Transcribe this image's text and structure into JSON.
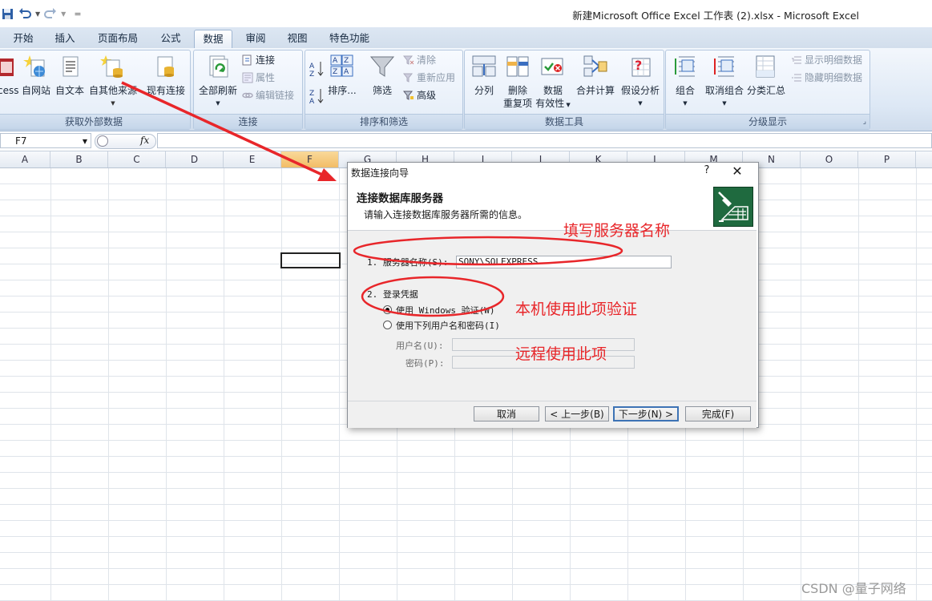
{
  "window": {
    "title": "新建Microsoft Office Excel 工作表 (2).xlsx - Microsoft Excel"
  },
  "quick_access": {
    "separator": "="
  },
  "tabs": [
    {
      "label": "开始",
      "active": false
    },
    {
      "label": "插入",
      "active": false
    },
    {
      "label": "页面布局",
      "active": false
    },
    {
      "label": "公式",
      "active": false
    },
    {
      "label": "数据",
      "active": true
    },
    {
      "label": "审阅",
      "active": false
    },
    {
      "label": "视图",
      "active": false
    },
    {
      "label": "特色功能",
      "active": false
    }
  ],
  "ribbon": {
    "groups": {
      "external": {
        "label": "获取外部数据",
        "buttons": [
          "cess",
          "自网站",
          "自文本",
          "自其他来源",
          "现有连接"
        ]
      },
      "connections": {
        "label": "连接",
        "refresh_all": "全部刷新",
        "connections": "连接",
        "properties": "属性",
        "edit_links": "编辑链接"
      },
      "sort_filter": {
        "label": "排序和筛选",
        "sort": "排序...",
        "filter": "筛选",
        "clear": "清除",
        "reapply": "重新应用",
        "advanced": "高级"
      },
      "data_tools": {
        "label": "数据工具",
        "text_to_columns": "分列",
        "remove_dup_1": "删除",
        "remove_dup_2": "重复项",
        "validation_1": "数据",
        "validation_2": "有效性",
        "consolidate": "合并计算",
        "what_if": "假设分析"
      },
      "outline": {
        "label": "分级显示",
        "group": "组合",
        "ungroup": "取消组合",
        "subtotal": "分类汇总",
        "show_detail": "显示明细数据",
        "hide_detail": "隐藏明细数据"
      }
    }
  },
  "formula_bar": {
    "name_box": "F7",
    "fx": "fx",
    "value": ""
  },
  "sheet": {
    "columns": [
      "A",
      "B",
      "C",
      "D",
      "E",
      "F",
      "G",
      "H",
      "I",
      "J",
      "K",
      "L",
      "M",
      "N",
      "O",
      "P"
    ],
    "selected_column": "F",
    "selected_cell": "F7"
  },
  "dialog": {
    "title": "数据连接向导",
    "help": "?",
    "close": "✕",
    "heading": "连接数据库服务器",
    "subheading": "请输入连接数据库服务器所需的信息。",
    "step1_label": "1. 服务器名称(S):",
    "server_name": "SONY\\SQLEXPRESS",
    "step2_label": "2. 登录凭据",
    "radio_windows": "使用 Windows 验证(W)",
    "radio_user": "使用下列用户名和密码(I)",
    "username_label": "用户名(U):",
    "password_label": "密码(P):",
    "btn_cancel": "取消",
    "btn_back": "< 上一步(B)",
    "btn_next": "下一步(N) >",
    "btn_finish": "完成(F)"
  },
  "annotations": {
    "server_note": "填写服务器名称",
    "local_note": "本机使用此项验证",
    "remote_note": "远程使用此项"
  },
  "watermark": "CSDN @量子网络",
  "colors": {
    "annotation_red": "#e8262a",
    "ribbon_blue": "#dde8f5",
    "selected_column": "#f2bd66"
  }
}
